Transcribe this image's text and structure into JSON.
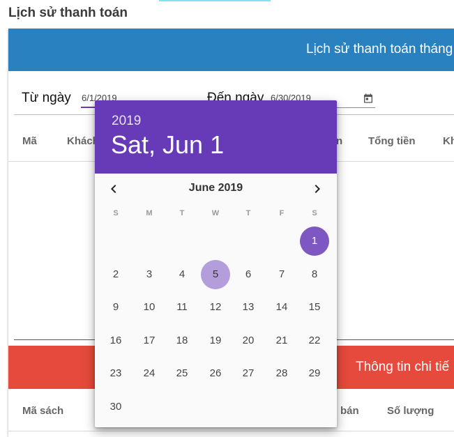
{
  "page": {
    "title": "Lịch sử thanh toán"
  },
  "payments": {
    "banner": "Lịch sử thanh toán tháng",
    "filter": {
      "from_label": "Từ ngày",
      "from_value": "6/1/2019",
      "to_label": "Đến ngày",
      "to_value": "6/30/2019"
    },
    "columns": [
      "Mã",
      "Khách",
      "n",
      "Tổng tiền",
      "Kh"
    ]
  },
  "details": {
    "banner": "Thông tin chi tiế",
    "columns": [
      "Mã sách",
      "bán",
      "Số lượng"
    ]
  },
  "datepicker": {
    "year": "2019",
    "selected_label": "Sat, Jun 1",
    "month_label": "June 2019",
    "weekdays": [
      "S",
      "M",
      "T",
      "W",
      "T",
      "F",
      "S"
    ],
    "first_weekday_index": 6,
    "days_in_month": 30,
    "selected_day": 1,
    "today_day": 5,
    "accent_color": "#673ab7"
  }
}
